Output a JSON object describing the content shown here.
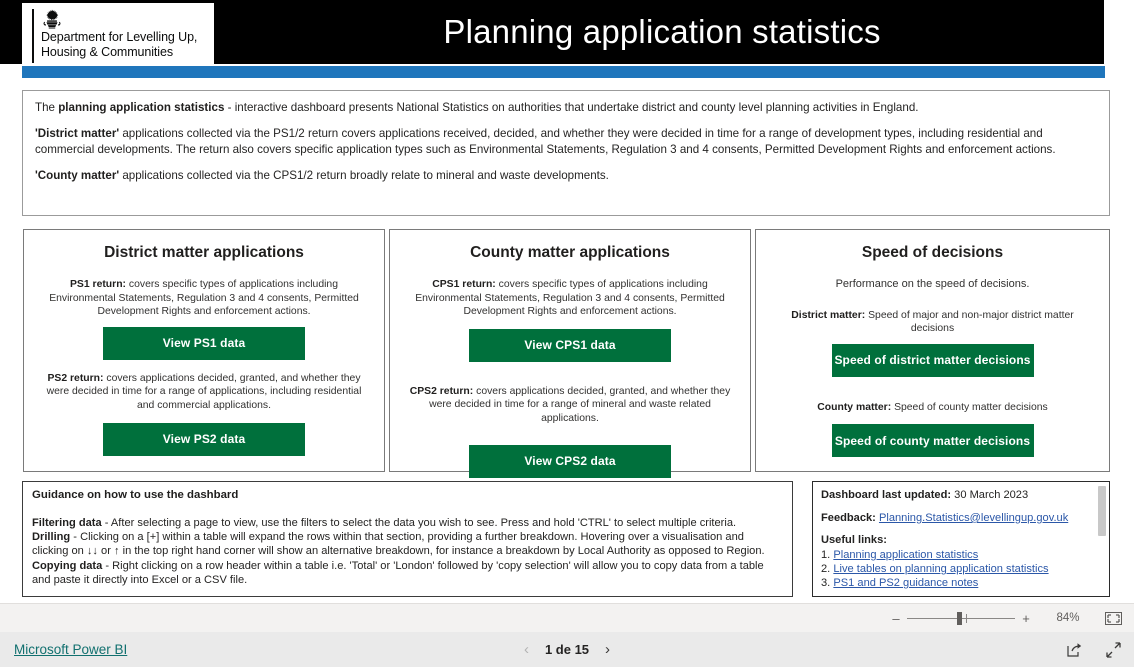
{
  "header": {
    "logo_line1": "Department for Levelling Up,",
    "logo_line2": "Housing & Communities",
    "crest_icon": "royal-crest-icon",
    "title": "Planning application statistics"
  },
  "intro": {
    "p1_lead": "The ",
    "p1_bold": "planning application statistics",
    "p1_rest": " - interactive dashboard presents National Statistics on authorities that undertake district and county level planning activities in England.",
    "p2_bold": "'District matter'",
    "p2_rest": " applications collected via the PS1/2 return covers applications received, decided, and whether they were decided in time for a range of development types, including residential and commercial developments. The return also covers specific application types such as Environmental Statements, Regulation 3 and 4 consents, Permitted Development Rights and enforcement actions.",
    "p3_bold": "'County matter'",
    "p3_rest": " applications collected via the CPS1/2 return broadly relate to mineral and waste developments."
  },
  "cards": {
    "district": {
      "title": "District matter applications",
      "ps1_bold": "PS1 return:",
      "ps1_text": " covers specific types of applications including Environmental Statements, Regulation 3 and 4 consents, Permitted Development Rights and enforcement actions.",
      "ps1_button": "View PS1 data",
      "ps2_bold": "PS2 return:",
      "ps2_text": " covers applications decided, granted, and whether they were decided in time for a range of applications, including residential and commercial applications.",
      "ps2_button": "View PS2 data"
    },
    "county": {
      "title": "County matter applications",
      "cps1_bold": "CPS1 return:",
      "cps1_text": " covers specific types of applications including Environmental Statements, Regulation 3 and 4 consents, Permitted Development Rights and enforcement actions.",
      "cps1_button": "View CPS1 data",
      "cps2_bold": "CPS2 return:",
      "cps2_text": " covers applications decided, granted, and whether they were decided in time for a range of mineral and waste related applications.",
      "cps2_button": "View CPS2 data"
    },
    "speed": {
      "title": "Speed of decisions",
      "subtitle": "Performance on the speed of decisions.",
      "district_bold": "District matter:",
      "district_text": " Speed of major and non-major district matter decisions",
      "district_button": "Speed of district matter decisions",
      "county_bold": "County matter:",
      "county_text": " Speed of county matter decisions",
      "county_button": "Speed of county matter decisions"
    }
  },
  "guidance": {
    "heading": "Guidance on how to use the dashbard",
    "filtering_bold": "Filtering data",
    "filtering_text": " - After selecting a page to view, use the filters to select the data you wish to see. Press and hold 'CTRL' to select multiple criteria.",
    "drilling_bold": "Drilling",
    "drilling_text": " - Clicking on a [+] within a table will expand the rows within that section, providing a further breakdown. Hovering over a visualisation and clicking on ↓↓ or ↑ in the top right hand corner will show an alternative breakdown, for instance a breakdown by Local Authority as opposed to Region.",
    "copying_bold": "Copying data",
    "copying_text": " - Right clicking on a row header within a table i.e. 'Total' or 'London' followed by 'copy selection' will allow you to copy data from a table and paste it directly into Excel or a CSV file."
  },
  "info": {
    "updated_label": "Dashboard last updated:",
    "updated_value": " 30 March 2023",
    "feedback_label": "Feedback:",
    "feedback_email": "Planning.Statistics@levellingup.gov.uk",
    "links_label": "Useful links:",
    "links": [
      {
        "num": "1. ",
        "text": "Planning application statistics"
      },
      {
        "num": "2. ",
        "text": "Live tables on planning application statistics"
      },
      {
        "num": "3. ",
        "text": "PS1 and PS2 guidance notes"
      }
    ]
  },
  "zoombar": {
    "minus": "–",
    "plus": "+",
    "percent": "84%",
    "fit_icon": "fit-to-page-icon"
  },
  "footer": {
    "powerbi_label": "Microsoft Power BI",
    "prev_icon": "chevron-left-icon",
    "next_icon": "chevron-right-icon",
    "page_label": "1 de 15",
    "share_icon": "share-icon",
    "fullscreen_icon": "fullscreen-icon"
  },
  "colors": {
    "header_black": "#000000",
    "accent_blue": "#1f76bc",
    "button_green": "#00703c",
    "link_blue": "#2b57a8",
    "powerbi_teal": "#11706f"
  }
}
